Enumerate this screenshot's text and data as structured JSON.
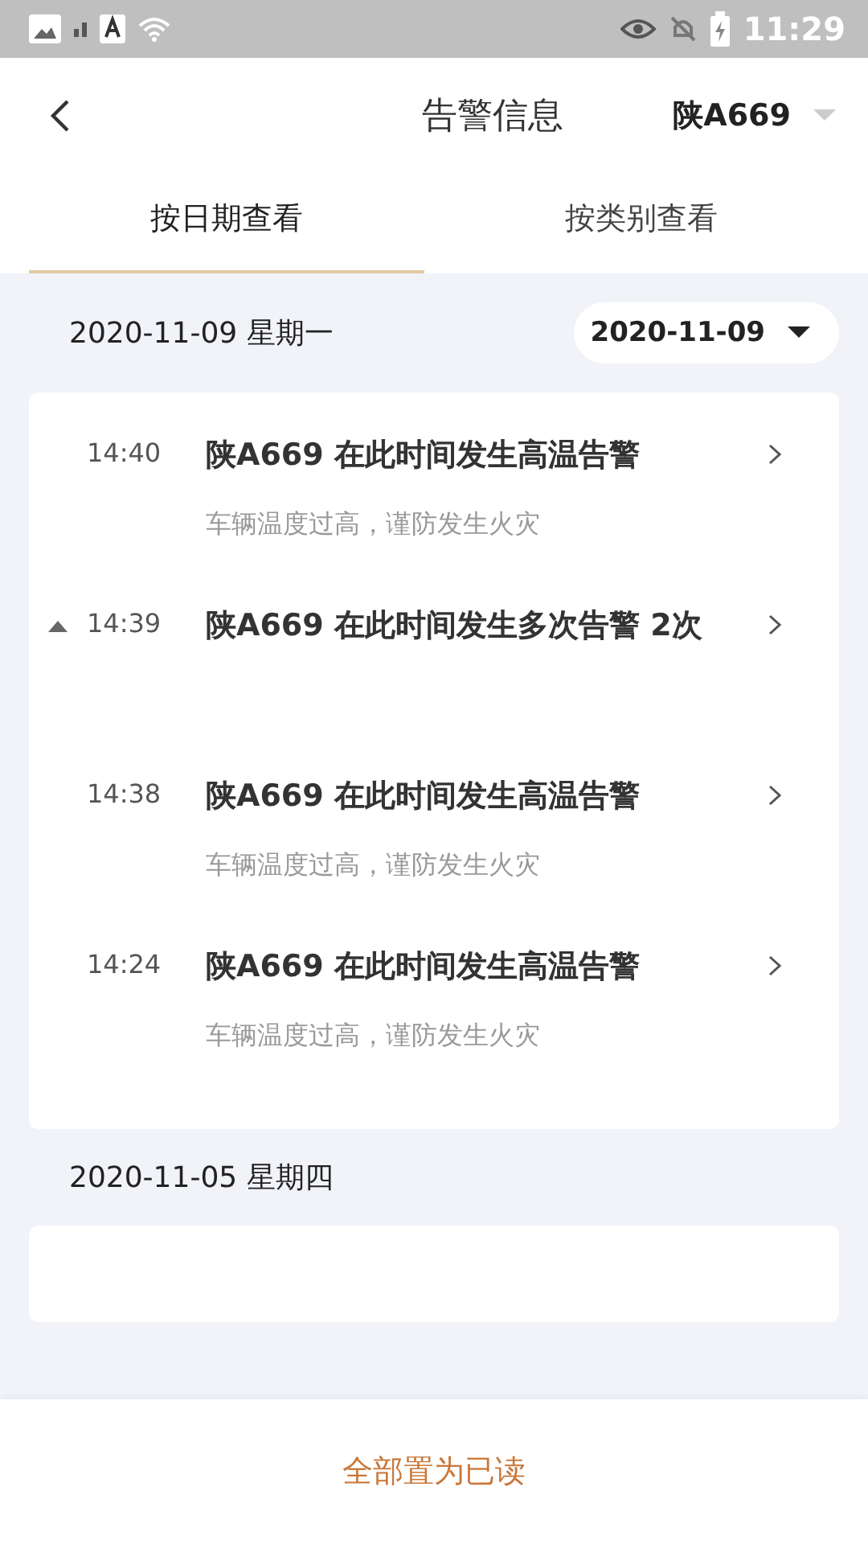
{
  "status_bar": {
    "time": "11:29"
  },
  "header": {
    "title": "告警信息",
    "vehicle": "陕A669"
  },
  "tabs": [
    {
      "label": "按日期查看",
      "selected": true
    },
    {
      "label": "按类别查看",
      "selected": false
    }
  ],
  "date_picker": {
    "value": "2020-11-09"
  },
  "days": [
    {
      "date": "2020-11-09 星期一",
      "alerts": [
        {
          "kind": "single",
          "time": "14:40",
          "title": "陕A669 在此时间发生高温告警",
          "detail": "车辆温度过高，谨防发生火灾"
        },
        {
          "kind": "group",
          "expanded": true,
          "time": "14:39",
          "title": "陕A669 在此时间发生多次告警 2次"
        },
        {
          "kind": "single",
          "time": "14:38",
          "title": "陕A669 在此时间发生高温告警",
          "detail": "车辆温度过高，谨防发生火灾"
        },
        {
          "kind": "single",
          "time": "14:24",
          "title": "陕A669 在此时间发生高温告警",
          "detail": "车辆温度过高，谨防发生火灾"
        }
      ]
    },
    {
      "date": "2020-11-05 星期四"
    }
  ],
  "footer": {
    "action": "全部置为已读"
  }
}
